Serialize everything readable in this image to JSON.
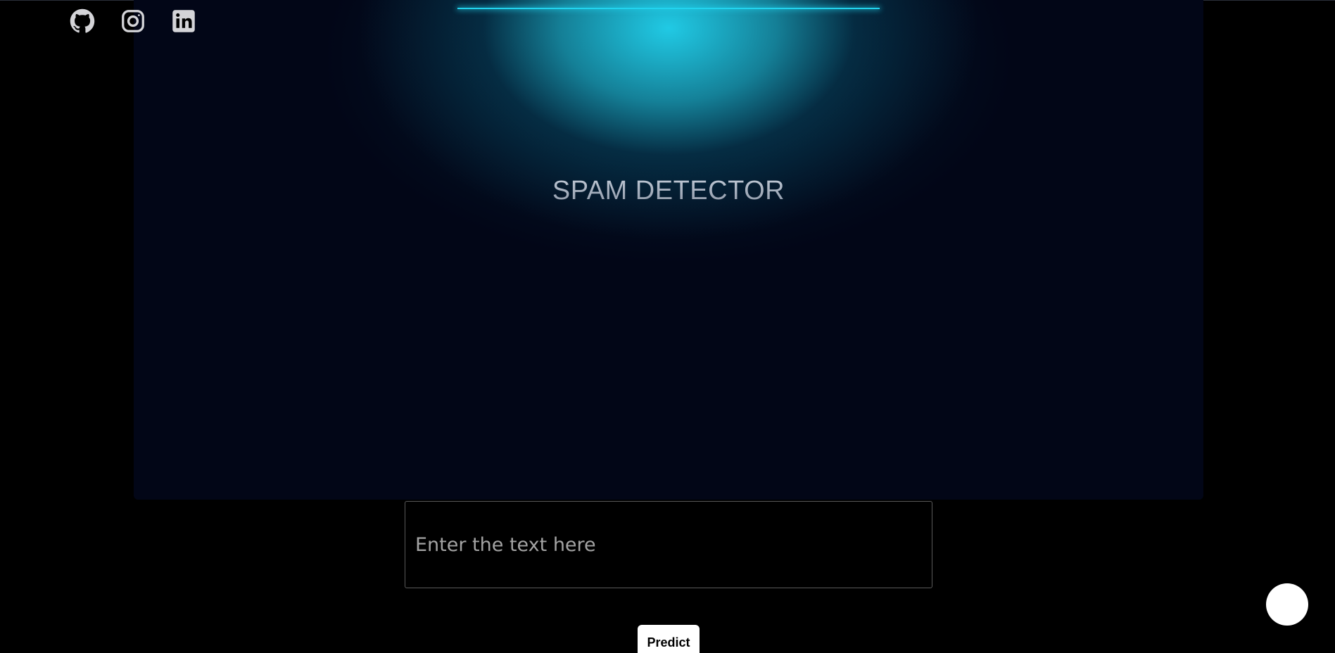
{
  "social": {
    "items": [
      {
        "icon": "github-icon",
        "label": "GitHub"
      },
      {
        "icon": "instagram-icon",
        "label": "Instagram"
      },
      {
        "icon": "linkedin-icon",
        "label": "LinkedIn"
      }
    ]
  },
  "hero": {
    "title": "SPAM DETECTOR",
    "accent_color": "#22d3ee",
    "background_color": "#020617"
  },
  "form": {
    "input_placeholder": "Enter the text here",
    "input_value": "",
    "predict_label": "Predict"
  },
  "colors": {
    "page_background": "#000000",
    "button_background": "#ffffff",
    "icon_color": "#d4d4d8"
  }
}
